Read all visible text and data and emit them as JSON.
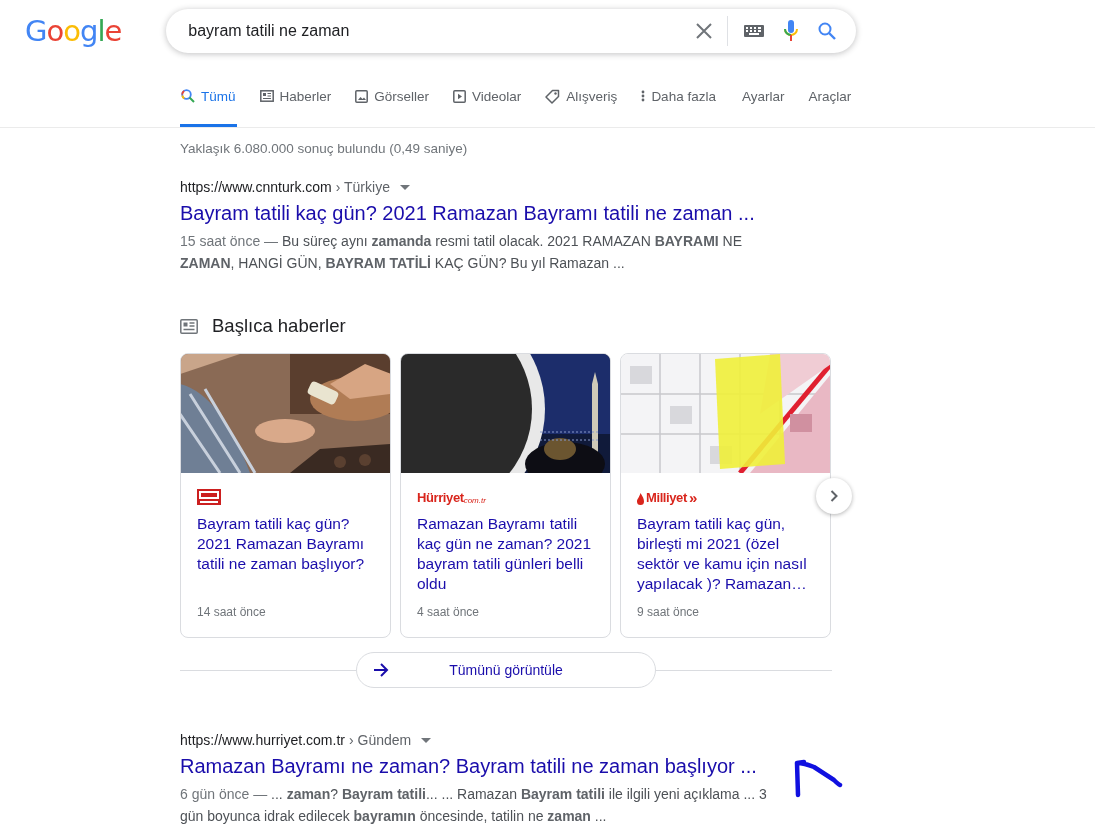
{
  "logo": "Google",
  "search": {
    "value": "bayram tatili ne zaman"
  },
  "tabs": [
    {
      "label": "Tümü",
      "selected": true
    },
    {
      "label": "Haberler",
      "selected": false
    },
    {
      "label": "Görseller",
      "selected": false
    },
    {
      "label": "Videolar",
      "selected": false
    },
    {
      "label": "Alışveriş",
      "selected": false
    },
    {
      "label": "Daha fazla",
      "selected": false
    },
    {
      "label": "Ayarlar",
      "selected": false
    },
    {
      "label": "Araçlar",
      "selected": false
    }
  ],
  "stats": "Yaklaşık 6.080.000 sonuç bulundu (0,49 saniye)",
  "results": [
    {
      "url": "https://www.cnnturk.com",
      "crumb": "› Türkiye",
      "title": "Bayram tatili kaç gün? 2021 Ramazan Bayramı tatili ne zaman ...",
      "date": "15 saat önce —",
      "snippet": "Bu süreç aynı **zamanda** resmi tatil olacak. 2021 RAMAZAN **BAYRAMI** NE **ZAMAN**, HANGİ GÜN, **BAYRAM TATİLİ** KAÇ GÜN? Bu yıl Ramazan ..."
    }
  ],
  "top_stories": {
    "heading": "Başlıca haberler",
    "cards": [
      {
        "source": {
          "kind": "cnn"
        },
        "title": "Bayram tatili kaç gün? 2021 Ramazan Bayramı tatili ne zaman başlıyor?",
        "time": "14 saat önce"
      },
      {
        "source": {
          "kind": "text",
          "name": "Hürriyet",
          "sub": "com.tr"
        },
        "title": "Ramazan Bayramı tatili kaç gün ne zaman? 2021 bayram tatili günleri belli oldu",
        "time": "4 saat önce"
      },
      {
        "source": {
          "kind": "text",
          "name": "Milliyet",
          "mark": "»"
        },
        "title": "Bayram tatili kaç gün, birleşti mi 2021 (özel sektör ve kamu için nasıl yapılacak )? Ramazan…",
        "time": "9 saat önce"
      }
    ],
    "view_all": "Tümünü görüntüle"
  },
  "results_after": [
    {
      "url": "https://www.hurriyet.com.tr",
      "crumb": "› Gündem",
      "title": "Ramazan Bayramı ne zaman? Bayram tatili ne zaman başlıyor ...",
      "date": "6 gün önce —",
      "snippet": "... **zaman**? **Bayram tatili**... ... Ramazan **Bayram tatili** ile ilgili yeni açıklama ... 3 gün boyunca idrak edilecek **bayramın** öncesinde, tatilin ne **zaman** ..."
    }
  ],
  "annotation": {
    "kind": "arrow"
  }
}
